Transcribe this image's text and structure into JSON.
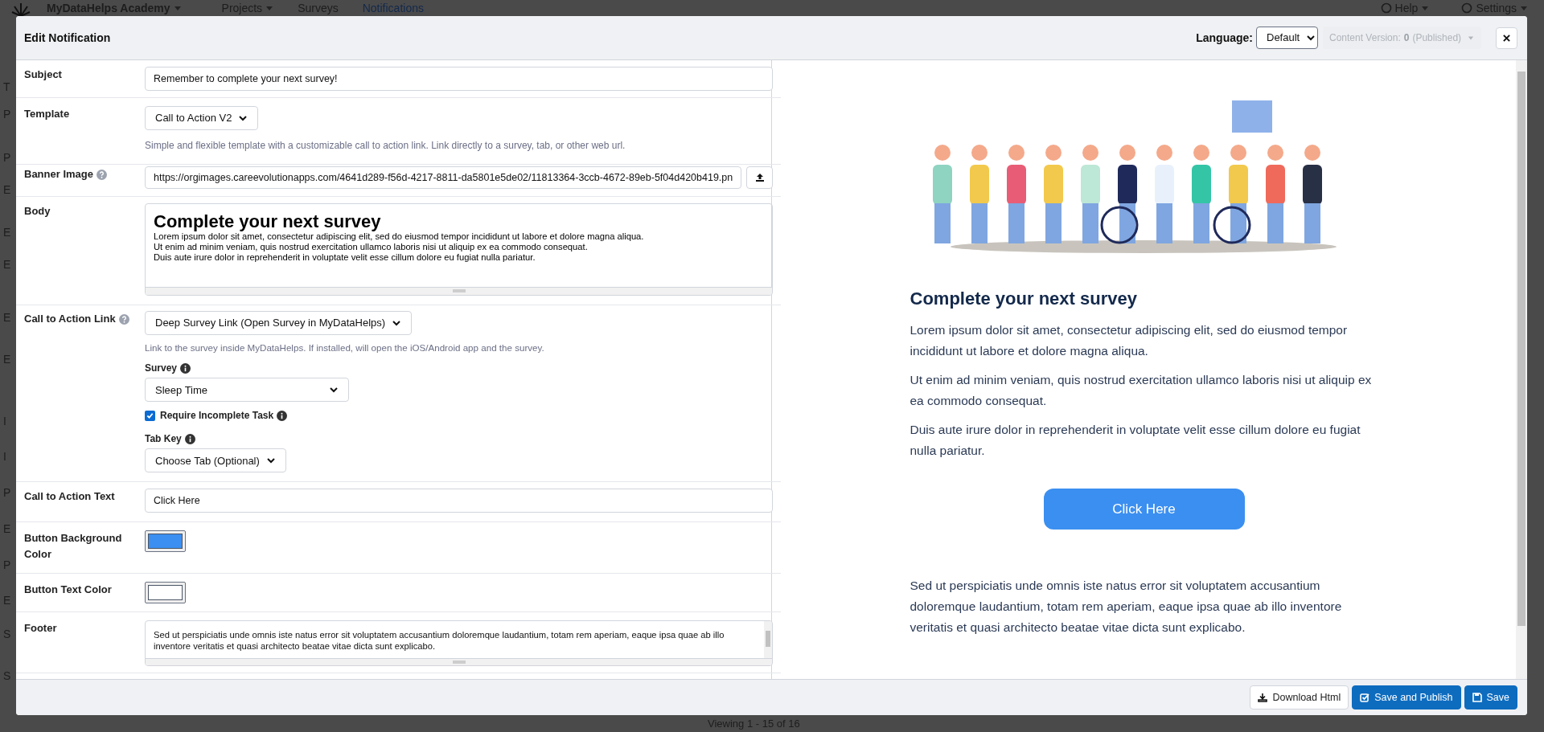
{
  "app_nav": {
    "brand": "MyDataHelps Academy",
    "items": [
      {
        "label": "Projects",
        "dropdown": true,
        "selected": false
      },
      {
        "label": "Surveys",
        "dropdown": false,
        "selected": false
      },
      {
        "label": "Notifications",
        "dropdown": false,
        "selected": true
      }
    ],
    "right_items": [
      {
        "label": "Help",
        "dropdown": true
      },
      {
        "label": "Settings",
        "dropdown": true
      }
    ]
  },
  "background_rows": [
    "T",
    "P",
    "P",
    "E",
    "E",
    "E",
    "E",
    "E",
    "I",
    "I",
    "P",
    "E",
    "P",
    "E",
    "S",
    "S"
  ],
  "pagination": "Viewing 1 - 15 of 16",
  "dialog": {
    "title": "Edit Notification",
    "language_label": "Language:",
    "language": "Default",
    "content_version": {
      "label": "Content Version:",
      "number": "0",
      "status": "(Published)",
      "disabled": true
    },
    "fields": [
      {
        "kind": "text",
        "label": "Subject",
        "value": "Remember to complete your next survey!"
      },
      {
        "kind": "select",
        "label": "Template",
        "value": "Call to Action V2",
        "help_text": "Simple and flexible template with a customizable call to action link. Link directly to a survey, tab, or other web url."
      },
      {
        "kind": "file",
        "label": "Banner Image",
        "help_icon": true,
        "value": "https://orgimages.careevolutionapps.com/4641d289-f56d-4217-8811-da5801e5de02/11813364-3ccb-4672-89eb-5f04d420b419.pn"
      },
      {
        "kind": "richtext",
        "label": "Body",
        "heading": "Complete your next survey",
        "lines": [
          "Lorem ipsum dolor sit amet, consectetur adipiscing elit, sed do eiusmod tempor incididunt ut labore et dolore magna aliqua.",
          "Ut enim ad minim veniam, quis nostrud exercitation ullamco laboris nisi ut aliquip ex ea commodo consequat.",
          "Duis aute irure dolor in reprehenderit in voluptate velit esse cillum dolore eu fugiat nulla pariatur."
        ]
      },
      {
        "kind": "cta",
        "label": "Call to Action Link",
        "help_icon": true,
        "value": "Deep Survey Link (Open Survey in MyDataHelps)",
        "help_text": "Link to the survey inside MyDataHelps. If installed, will open the iOS/Android app and the survey.",
        "survey": {
          "label": "Survey",
          "value": "Sleep Time"
        },
        "require": {
          "label": "Require Incomplete Task",
          "checked": true
        },
        "tab_key": {
          "label": "Tab Key",
          "value": "Choose Tab (Optional)"
        }
      },
      {
        "kind": "text",
        "label": "Call to Action Text",
        "value": "Click Here"
      },
      {
        "kind": "color",
        "label": "Button Background Color",
        "color": "#3b8ff0"
      },
      {
        "kind": "color",
        "label": "Button Text Color",
        "color": "#ffffff"
      },
      {
        "kind": "textarea",
        "label": "Footer",
        "value": "Sed ut perspiciatis unde omnis iste natus error sit voluptatem accusantium doloremque laudantium, totam rem aperiam, eaque ipsa quae ab illo inventore veritatis et quasi architecto beatae vitae dicta sunt explicabo."
      }
    ],
    "preview": {
      "heading": "Complete your next survey",
      "paragraphs": [
        "Lorem ipsum dolor sit amet, consectetur adipiscing elit, sed do eiusmod tempor incididunt ut labore et dolore magna aliqua.",
        "Ut enim ad minim veniam, quis nostrud exercitation ullamco laboris nisi ut aliquip ex ea commodo consequat.",
        "Duis aute irure dolor in reprehenderit in voluptate velit esse cillum dolore eu fugiat nulla pariatur."
      ],
      "button": "Click Here",
      "footer": "Sed ut perspiciatis unde omnis iste natus error sit voluptatem accusantium doloremque laudantium, totam rem aperiam, eaque ipsa quae ab illo inventore veritatis et quasi architecto beatae vitae dicta sunt explicabo."
    },
    "buttons": [
      {
        "label": "Download Html",
        "kind": "secondary"
      },
      {
        "label": "Save and Publish",
        "kind": "primary"
      },
      {
        "label": "Save",
        "kind": "primary"
      }
    ]
  }
}
